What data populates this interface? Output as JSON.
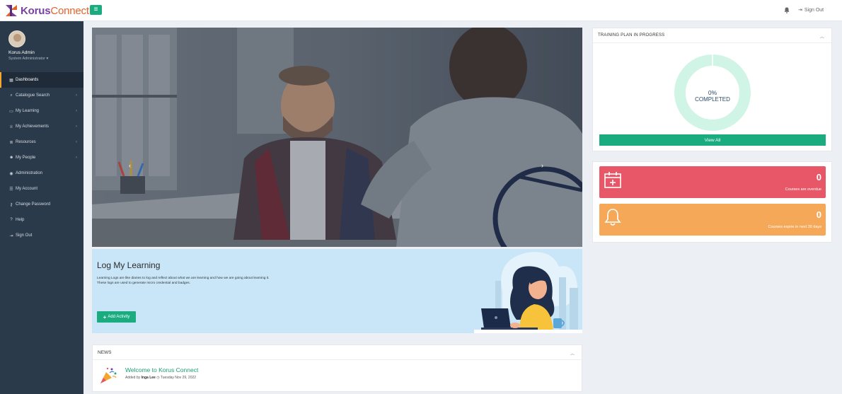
{
  "app": {
    "logo_korus": "Korus",
    "logo_connect": "Connect",
    "brand_purple": "#7b3fa0",
    "brand_orange": "#e3632d",
    "accent": "#1aab7e"
  },
  "topbar": {
    "menu_icon": "hamburger-icon",
    "bell_icon": "bell-icon",
    "signout_label": "Sign Out"
  },
  "user": {
    "name": "Korus Admin",
    "role": "System Administrator ▾"
  },
  "sidebar": {
    "items": [
      {
        "label": "Dashboards",
        "icon": "dashboard-icon",
        "active": true,
        "chevron": false
      },
      {
        "label": "Catalogue Search",
        "icon": "search-icon",
        "active": false,
        "chevron": true
      },
      {
        "label": "My Learning",
        "icon": "monitor-icon",
        "active": false,
        "chevron": true
      },
      {
        "label": "My Achievements",
        "icon": "trophy-icon",
        "active": false,
        "chevron": true
      },
      {
        "label": "Resources",
        "icon": "database-icon",
        "active": false,
        "chevron": true
      },
      {
        "label": "My People",
        "icon": "people-icon",
        "active": false,
        "chevron": true
      },
      {
        "label": "Administration",
        "icon": "user-circle-icon",
        "active": false,
        "chevron": false
      },
      {
        "label": "My Account",
        "icon": "account-icon",
        "active": false,
        "chevron": false
      },
      {
        "label": "Change Password",
        "icon": "key-icon",
        "active": false,
        "chevron": false
      },
      {
        "label": "Help",
        "icon": "help-icon",
        "active": false,
        "chevron": false
      },
      {
        "label": "Sign Out",
        "icon": "signout-icon",
        "active": false,
        "chevron": false
      }
    ]
  },
  "carousel": {
    "prev": "‹",
    "next": "›",
    "slide_count": 4,
    "active_slide": 2
  },
  "log": {
    "title": "Log My Learning",
    "desc_line1": "Learning Logs are like diaries to log and reflect about what we are learning and how we are going about learning it.",
    "desc_line2": "These logs are used to generate micro credential and badges.",
    "add_label": "Add Activity"
  },
  "news": {
    "header": "NEWS",
    "items": [
      {
        "title": "Welcome to Korus Connect",
        "added_by": "Added by",
        "author": "Inga Lee",
        "date": "Tuesday Nov 29, 2022"
      }
    ]
  },
  "training_plan": {
    "header": "TRAINING PLAN IN PROGRESS",
    "percent": "0%",
    "completed_label": "COMPLETED",
    "progress_fraction": 0,
    "view_all": "View All"
  },
  "stats": {
    "overdue": {
      "value": "0",
      "label": "Courses are overdue",
      "color": "#e85768",
      "icon": "calendar-plus-icon"
    },
    "expire": {
      "value": "0",
      "label": "Courses expire in next 30 days",
      "color": "#f5a858",
      "icon": "bell-icon"
    }
  }
}
